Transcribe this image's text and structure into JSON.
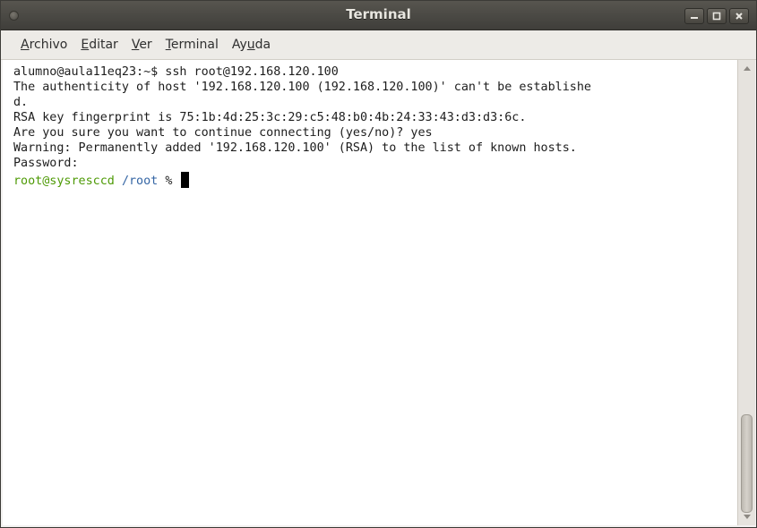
{
  "window": {
    "title": "Terminal"
  },
  "menu": {
    "items": [
      {
        "label": "Archivo",
        "mnemonic": "A"
      },
      {
        "label": "Editar",
        "mnemonic": "E"
      },
      {
        "label": "Ver",
        "mnemonic": "V"
      },
      {
        "label": "Terminal",
        "mnemonic": "T"
      },
      {
        "label": "Ayuda",
        "mnemonic": "u"
      }
    ]
  },
  "terminal": {
    "lines": [
      "alumno@aula11eq23:~$ ssh root@192.168.120.100",
      "The authenticity of host '192.168.120.100 (192.168.120.100)' can't be establishe",
      "d.",
      "RSA key fingerprint is 75:1b:4d:25:3c:29:c5:48:b0:4b:24:33:43:d3:d3:6c.",
      "Are you sure you want to continue connecting (yes/no)? yes",
      "Warning: Permanently added '192.168.120.100' (RSA) to the list of known hosts.",
      "Password:"
    ],
    "prompt": {
      "user_host": "root@sysresccd",
      "directory": "/root",
      "symbol": "%"
    }
  },
  "colors": {
    "prompt_user": "#4e9a06",
    "prompt_dir": "#3465a4",
    "titlebar": "#4a4843"
  },
  "icons": {
    "window_menu": "circle-icon",
    "minimize": "minimize-icon",
    "maximize": "maximize-icon",
    "close": "close-icon"
  }
}
